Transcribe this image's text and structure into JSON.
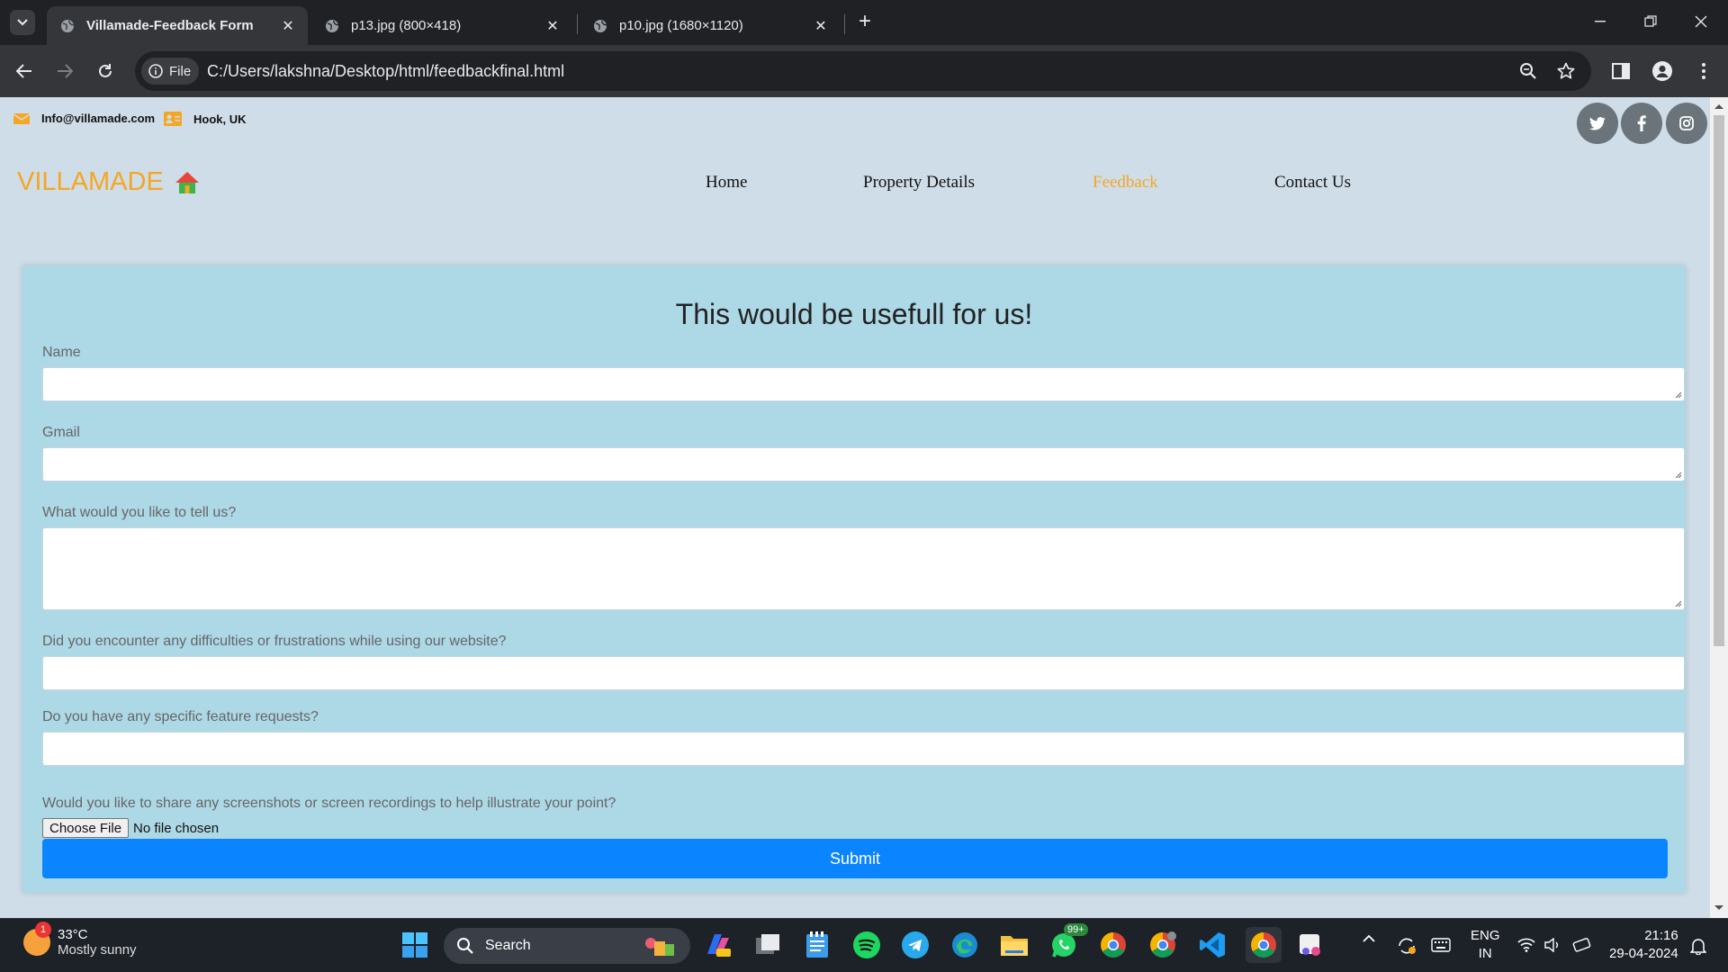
{
  "browser": {
    "tabs": [
      {
        "title": "Villamade-Feedback Form",
        "active": true
      },
      {
        "title": "p13.jpg (800×418)",
        "active": false
      },
      {
        "title": "p10.jpg (1680×1120)",
        "active": false
      }
    ],
    "site_chip_label": "File",
    "url": "C:/Users/lakshna/Desktop/html/feedbackfinal.html"
  },
  "topbar": {
    "email": "Info@villamade.com",
    "location": "Hook, UK",
    "social": [
      "twitter-icon",
      "facebook-icon",
      "instagram-icon"
    ]
  },
  "nav": {
    "brand": "VILLAMADE",
    "items": [
      {
        "label": "Home"
      },
      {
        "label": "Property Details"
      },
      {
        "label": "Feedback"
      },
      {
        "label": "Contact Us"
      }
    ],
    "active_color": "#f5a623"
  },
  "form": {
    "title": "This would be usefull for us!",
    "fields": [
      {
        "label": "Name",
        "value": ""
      },
      {
        "label": "Gmail",
        "value": ""
      },
      {
        "label": "What would you like to tell us?",
        "value": ""
      },
      {
        "label": "Did you encounter any difficulties or frustrations while using our website?",
        "value": ""
      },
      {
        "label": "Do you have any specific feature requests?",
        "value": ""
      },
      {
        "label": "Would you like to share any screenshots or screen recordings to help illustrate your point?"
      }
    ],
    "file_button": "Choose File",
    "file_status": "No file chosen",
    "submit": "Submit",
    "submit_color": "#0a84ff",
    "card_color": "#add8e6"
  },
  "taskbar": {
    "weather_temp": "33°C",
    "weather_desc": "Mostly sunny",
    "weather_badge": "1",
    "search_label": "Search",
    "whatsapp_badge": "99+",
    "lang_1": "ENG",
    "lang_2": "IN",
    "time": "21:16",
    "date": "29-04-2024"
  }
}
